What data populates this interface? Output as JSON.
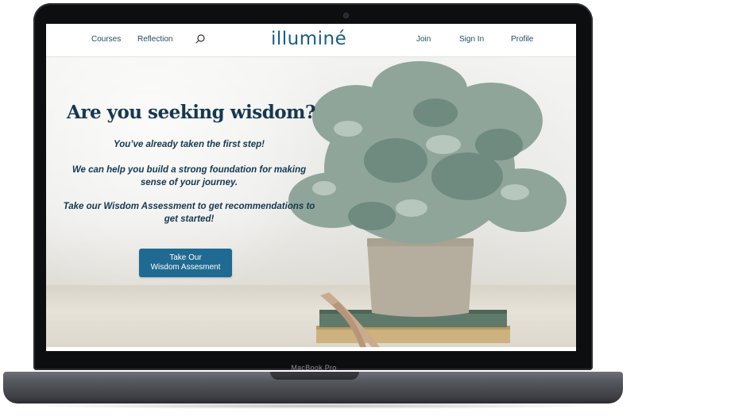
{
  "device": {
    "brand_label": "MacBook Pro"
  },
  "nav": {
    "courses": "Courses",
    "reflection": "Reflection",
    "logo": "illuminé",
    "join": "Join",
    "sign_in": "Sign In",
    "profile": "Profile"
  },
  "hero": {
    "title": "Are you seeking wisdom?",
    "line1": "You’ve already taken the first step!",
    "line2": "We can help you build a strong foundation for making sense of your journey.",
    "line3": "Take our Wisdom Assessment to get recommendations to get started!",
    "cta_line1": "Take Our",
    "cta_line2": "Wisdom Assesment"
  },
  "colors": {
    "brand": "#1a5d84",
    "cta": "#1f6a92",
    "heading": "#16384f"
  }
}
